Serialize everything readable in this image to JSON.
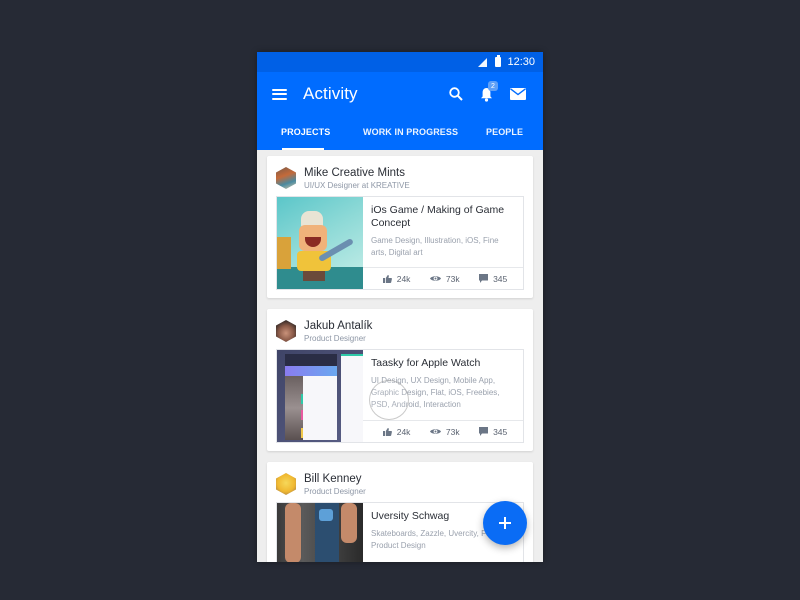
{
  "status_bar": {
    "time": "12:30"
  },
  "app_bar": {
    "title": "Activity",
    "notification_count": "2",
    "icons": [
      "menu-icon",
      "search-icon",
      "bell-icon",
      "mail-icon"
    ]
  },
  "tabs": [
    {
      "label": "PROJECTS",
      "active": true
    },
    {
      "label": "WORK IN PROGRESS",
      "active": false
    },
    {
      "label": "PEOPLE",
      "active": false
    }
  ],
  "feed": [
    {
      "author": "Mike Creative Mints",
      "role": "UI/UX Designer at KREATIVE",
      "project_title": "iOs Game / Making of Game Concept",
      "tags": "Game Design, Illustration, iOS, Fine arts, Digital art",
      "likes": "24k",
      "views": "73k",
      "comments": "345"
    },
    {
      "author": "Jakub Antalík",
      "role": "Product Designer",
      "project_title": "Taasky for Apple Watch",
      "tags": "UI Design, UX Design, Mobile App, Graphic Design, Flat, iOS, Freebies, PSD, Android, Interaction",
      "likes": "24k",
      "views": "73k",
      "comments": "345"
    },
    {
      "author": "Bill Kenney",
      "role": "Product Designer",
      "project_title": "Uversity Schwag",
      "tags": "Skateboards, Zazzle, Uvercity, Food, Product Design",
      "likes": "",
      "views": "",
      "comments": ""
    }
  ],
  "fab": {
    "icon": "plus-icon"
  },
  "colors": {
    "primary": "#006cff",
    "status_bar": "#0060e6",
    "background": "#262a35"
  }
}
